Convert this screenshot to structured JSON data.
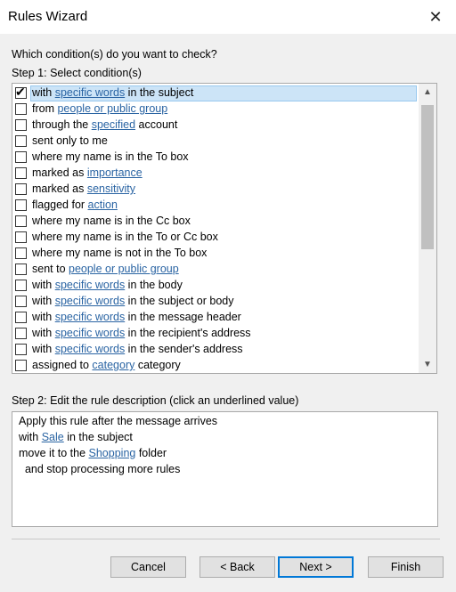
{
  "window": {
    "title": "Rules Wizard",
    "close_glyph": "✕"
  },
  "question": "Which condition(s) do you want to check?",
  "step1_label": "Step 1: Select condition(s)",
  "conditions": [
    {
      "checked": true,
      "parts": [
        "with ",
        "specific words",
        " in the subject"
      ]
    },
    {
      "checked": false,
      "parts": [
        "from ",
        "people or public group",
        ""
      ]
    },
    {
      "checked": false,
      "parts": [
        "through the ",
        "specified",
        " account"
      ]
    },
    {
      "checked": false,
      "parts": [
        "sent only to me",
        "",
        ""
      ]
    },
    {
      "checked": false,
      "parts": [
        "where my name is in the To box",
        "",
        ""
      ]
    },
    {
      "checked": false,
      "parts": [
        "marked as ",
        "importance",
        ""
      ]
    },
    {
      "checked": false,
      "parts": [
        "marked as ",
        "sensitivity",
        ""
      ]
    },
    {
      "checked": false,
      "parts": [
        "flagged for ",
        "action",
        ""
      ]
    },
    {
      "checked": false,
      "parts": [
        "where my name is in the Cc box",
        "",
        ""
      ]
    },
    {
      "checked": false,
      "parts": [
        "where my name is in the To or Cc box",
        "",
        ""
      ]
    },
    {
      "checked": false,
      "parts": [
        "where my name is not in the To box",
        "",
        ""
      ]
    },
    {
      "checked": false,
      "parts": [
        "sent to ",
        "people or public group",
        ""
      ]
    },
    {
      "checked": false,
      "parts": [
        "with ",
        "specific words",
        " in the body"
      ]
    },
    {
      "checked": false,
      "parts": [
        "with ",
        "specific words",
        " in the subject or body"
      ]
    },
    {
      "checked": false,
      "parts": [
        "with ",
        "specific words",
        " in the message header"
      ]
    },
    {
      "checked": false,
      "parts": [
        "with ",
        "specific words",
        " in the recipient's address"
      ]
    },
    {
      "checked": false,
      "parts": [
        "with ",
        "specific words",
        " in the sender's address"
      ]
    },
    {
      "checked": false,
      "parts": [
        "assigned to ",
        "category",
        " category"
      ]
    }
  ],
  "step2_label": "Step 2: Edit the rule description (click an underlined value)",
  "description": [
    {
      "parts": [
        "Apply this rule after the message arrives",
        "",
        ""
      ]
    },
    {
      "parts": [
        "with ",
        "Sale",
        " in the subject"
      ]
    },
    {
      "parts": [
        "move it to the ",
        "Shopping",
        " folder"
      ]
    },
    {
      "parts": [
        "  and stop processing more rules",
        "",
        ""
      ]
    }
  ],
  "buttons": {
    "cancel": "Cancel",
    "back": "< Back",
    "next": "Next >",
    "finish": "Finish"
  },
  "scroll_up_glyph": "▲",
  "scroll_down_glyph": "▼",
  "check_glyph": "✔",
  "colors": {
    "link": "#2a64a3",
    "selection": "#cce4f7",
    "default_button_border": "#0078d7"
  }
}
